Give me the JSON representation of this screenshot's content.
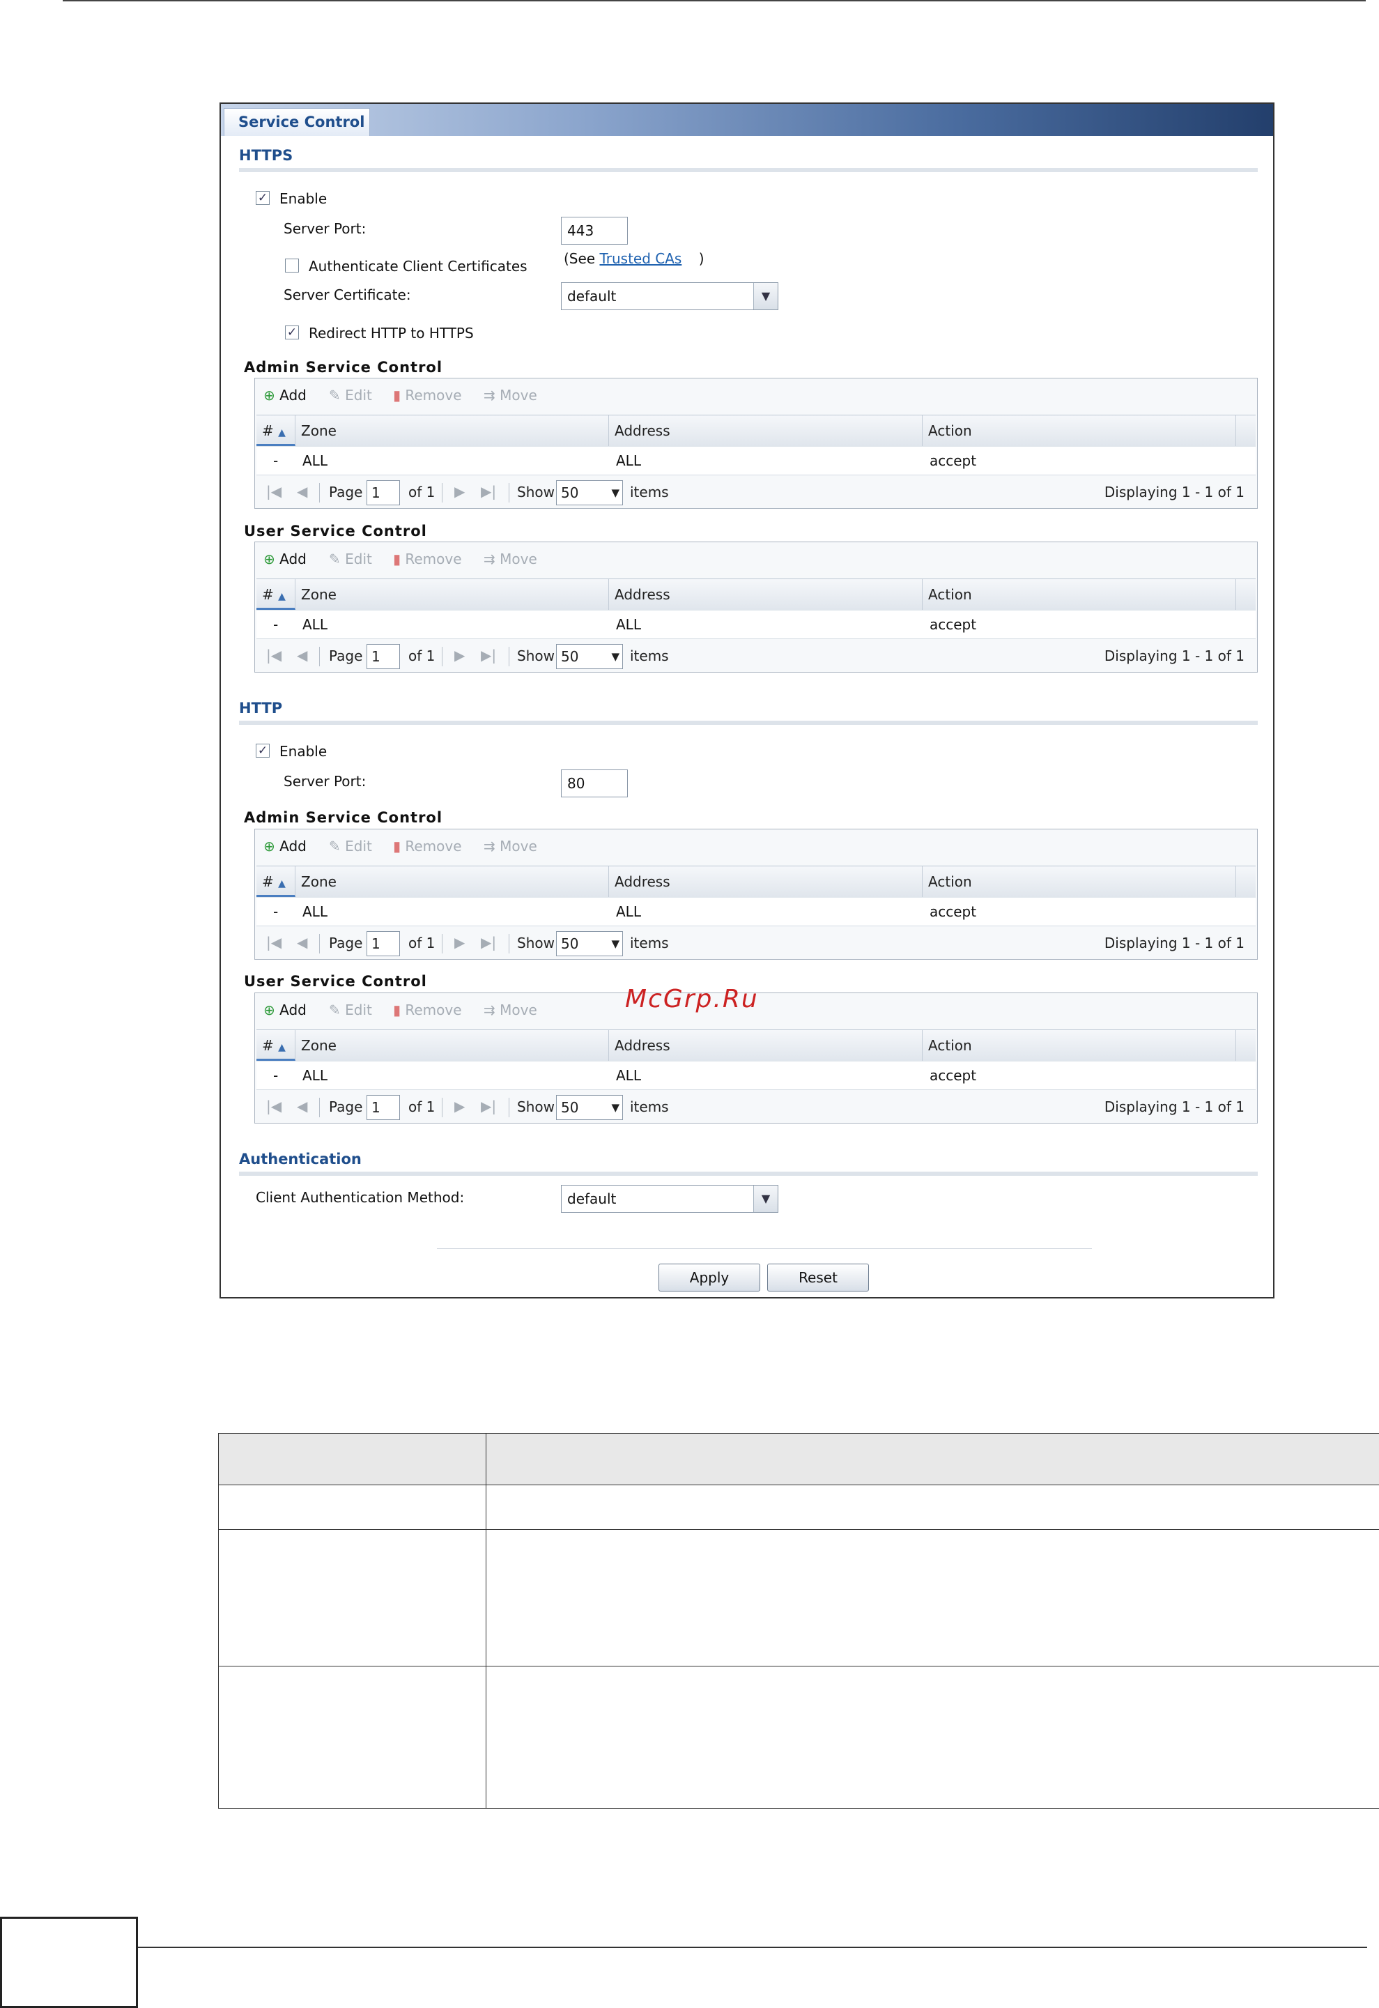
{
  "tab": "Service Control",
  "https": {
    "title": "HTTPS",
    "enable_label": "Enable",
    "enable_checked": true,
    "server_port_label": "Server Port:",
    "server_port_value": "443",
    "auth_client_cert_label": "Authenticate Client Certificates",
    "auth_client_cert_checked": false,
    "see_prefix": "(See",
    "see_link": "Trusted CAs",
    "see_suffix": ")",
    "server_cert_label": "Server Certificate:",
    "server_cert_value": "default",
    "redirect_label": "Redirect HTTP to HTTPS",
    "redirect_checked": true
  },
  "http": {
    "title": "HTTP",
    "enable_label": "Enable",
    "enable_checked": true,
    "server_port_label": "Server Port:",
    "server_port_value": "80"
  },
  "toolbar": {
    "add": "Add",
    "edit": "Edit",
    "remove": "Remove",
    "move": "Move"
  },
  "columns": {
    "num": "#",
    "zone": "Zone",
    "address": "Address",
    "action": "Action"
  },
  "pager": {
    "page": "Page",
    "page_value": "1",
    "of": "of 1",
    "show": "Show",
    "show_value": "50",
    "items": "items",
    "displaying": "Displaying 1 - 1 of 1"
  },
  "blocks": [
    {
      "title": "Admin Service Control",
      "row": {
        "num": "-",
        "zone": "ALL",
        "address": "ALL",
        "action": "accept"
      }
    },
    {
      "title": "User Service Control",
      "row": {
        "num": "-",
        "zone": "ALL",
        "address": "ALL",
        "action": "accept"
      }
    },
    {
      "title": "Admin Service Control",
      "row": {
        "num": "-",
        "zone": "ALL",
        "address": "ALL",
        "action": "accept"
      }
    },
    {
      "title": "User Service Control",
      "row": {
        "num": "-",
        "zone": "ALL",
        "address": "ALL",
        "action": "accept"
      }
    }
  ],
  "authentication": {
    "title": "Authentication",
    "method_label": "Client Authentication Method:",
    "method_value": "default"
  },
  "buttons": {
    "apply": "Apply",
    "reset": "Reset"
  },
  "watermark": "McGrp.Ru"
}
